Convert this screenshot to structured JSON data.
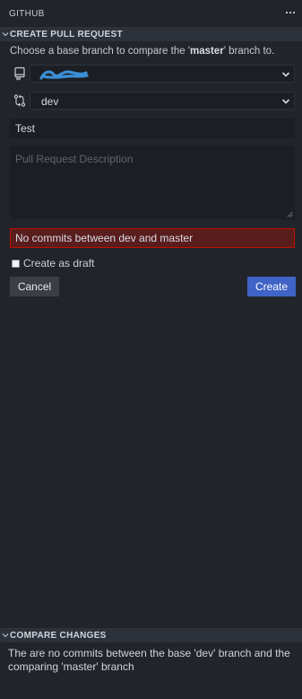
{
  "header": {
    "title": "GITHUB",
    "more_icon": "ellipsis-icon"
  },
  "create_pr": {
    "section_title": "CREATE PULL REQUEST",
    "hint_prefix": "Choose a base branch to compare the '",
    "hint_branch": "master",
    "hint_suffix": "' branch to.",
    "repo_select": {
      "icon": "repo-icon",
      "value": ""
    },
    "branch_select": {
      "icon": "git-compare-icon",
      "value": "dev"
    },
    "title_value": "Test",
    "description_placeholder": "Pull Request Description",
    "error_message": "No commits between dev and master",
    "draft_label": "Create as draft",
    "draft_checked": false,
    "cancel_label": "Cancel",
    "create_label": "Create"
  },
  "compare": {
    "section_title": "COMPARE CHANGES",
    "message": "The are no commits between the base 'dev' branch and the comparing 'master' branch"
  },
  "colors": {
    "background": "#21252b",
    "section_header": "#2c313a",
    "input_bg": "#1b1e23",
    "error_bg": "#5a1d1d",
    "error_border": "#be1100",
    "primary_button": "#3f63c6",
    "secondary_button": "#3a3f47",
    "redaction_scribble": "#3a8fd6"
  }
}
